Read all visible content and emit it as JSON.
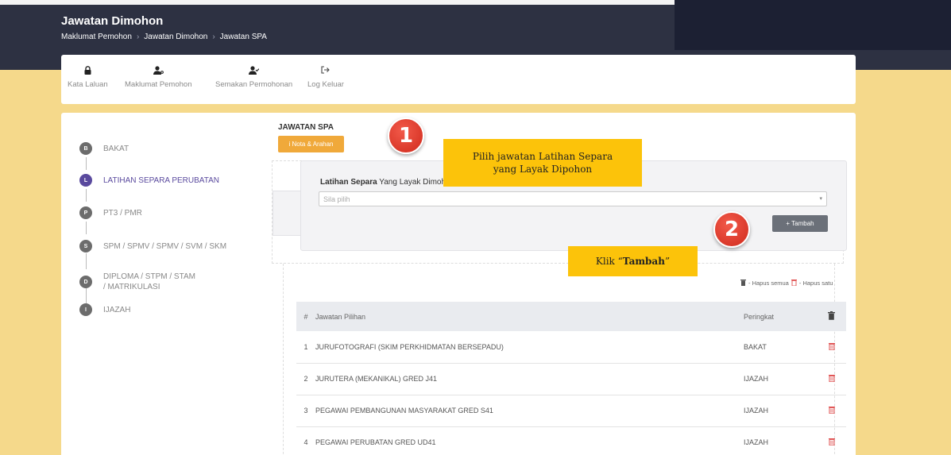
{
  "header": {
    "title": "Jawatan Dimohon",
    "breadcrumb": [
      "Maklumat Pemohon",
      "Jawatan Dimohon",
      "Jawatan SPA"
    ]
  },
  "nav": [
    {
      "label": "Kata Laluan",
      "icon": "lock-icon"
    },
    {
      "label": "Maklumat Pemohon",
      "icon": "user-key-icon"
    },
    {
      "label": "Semakan Permohonan",
      "icon": "user-check-icon"
    },
    {
      "label": "Log Keluar",
      "icon": "sign-out-icon"
    }
  ],
  "steps": [
    {
      "letter": "B",
      "label": "BAKAT",
      "active": false
    },
    {
      "letter": "L",
      "label": "LATIHAN SEPARA PERUBATAN",
      "active": true
    },
    {
      "letter": "P",
      "label": "PT3 / PMR",
      "active": false
    },
    {
      "letter": "S",
      "label": "SPM / SPMV / SPMV / SVM / SKM",
      "active": false
    },
    {
      "letter": "D",
      "label": "DIPLOMA / STPM / STAM / MATRIKULASI",
      "active": false
    },
    {
      "letter": "I",
      "label": "IJAZAH",
      "active": false
    }
  ],
  "main": {
    "section_title": "JAWATAN SPA",
    "nota_button": "i Nota & Arahan",
    "select_label_bold": "Latihan Separa",
    "select_label_rest": " Yang Layak Dimohon",
    "select_placeholder": "Sila pilih",
    "tambah_button": "+ Tambah",
    "hapus_semua": "- Hapus semua",
    "hapus_satu": "- Hapus satu"
  },
  "table": {
    "headers": [
      "#",
      "Jawatan Pilihan",
      "Peringkat"
    ],
    "rows": [
      {
        "no": "1",
        "jawatan": "JURUFOTOGRAFI (SKIM PERKHIDMATAN BERSEPADU)",
        "peringkat": "BAKAT"
      },
      {
        "no": "2",
        "jawatan": "JURUTERA (MEKANIKAL) GRED J41",
        "peringkat": "IJAZAH"
      },
      {
        "no": "3",
        "jawatan": "PEGAWAI PEMBANGUNAN MASYARAKAT GRED S41",
        "peringkat": "IJAZAH"
      },
      {
        "no": "4",
        "jawatan": "PEGAWAI PERUBATAN GRED UD41",
        "peringkat": "IJAZAH"
      }
    ]
  },
  "annotations": {
    "badge1": "1",
    "badge2": "2",
    "callout1": "Pilih jawatan Latihan Separa yang Layak Dipohon",
    "callout2_pre": "Klik “",
    "callout2_bold": "Tambah",
    "callout2_post": "”"
  },
  "colors": {
    "page_bg": "#f5d98b",
    "header_bg": "#2d3142",
    "accent_purple": "#5a4a9e",
    "nota_orange": "#f0a93a",
    "callout_yellow": "#fcc30a",
    "badge_red": "#d93a2b",
    "delete_red": "#e05252"
  }
}
